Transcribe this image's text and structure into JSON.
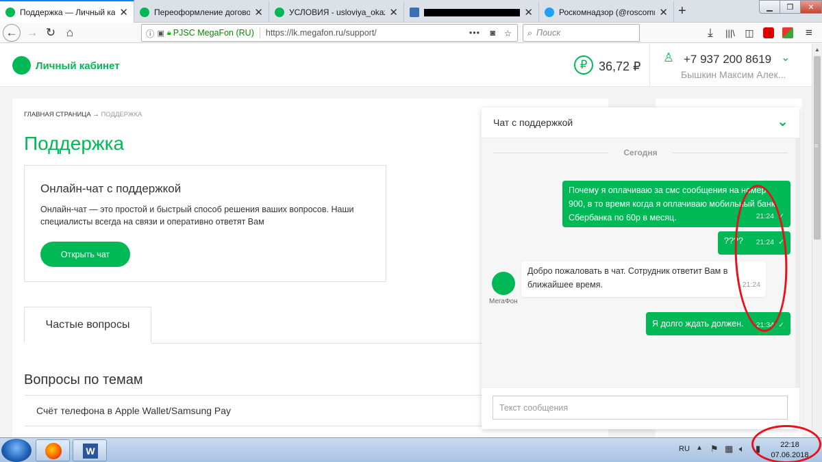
{
  "tabs": [
    {
      "label": "Поддержка — Личный кабинет",
      "icon": "megafon-logo-icon",
      "active": true
    },
    {
      "label": "Переоформление договора -",
      "icon": "megafon-logo-icon"
    },
    {
      "label": "УСЛОВИЯ - usloviya_okazaniya",
      "icon": "megafon-logo-icon"
    },
    {
      "label": "",
      "icon": "video-icon"
    },
    {
      "label": "Роскомнадзор (@roscomnadzor)",
      "icon": "twitter-icon"
    }
  ],
  "nav": {
    "identity": "PJSC MegaFon (RU)",
    "url": "https://lk.megafon.ru/support/",
    "search_placeholder": "Поиск"
  },
  "header": {
    "logo_text": "Личный кабинет",
    "balance": "36,72 ₽",
    "phone": "+7 937 200 8619",
    "user_name": "Бышкин Максим Алек..."
  },
  "breadcrumb": {
    "home": "ГЛАВНАЯ СТРАНИЦА",
    "arrow": "→",
    "current": "ПОДДЕРЖКА"
  },
  "page_title": "Поддержка",
  "online_chat": {
    "title": "Онлайн-чат с поддержкой",
    "description": "Онлайн-чат — это простой и быстрый способ решения ваших вопросов. Наши специалисты всегда на связи и оперативно ответят Вам",
    "button": "Открыть чат"
  },
  "faq_tab": "Частые вопросы",
  "topics": {
    "title": "Вопросы по темам",
    "items": [
      "Счёт телефона в Apple Wallet/Samsung Pay"
    ]
  },
  "chat": {
    "title": "Чат с поддержкой",
    "date_divider": "Сегодня",
    "messages": [
      {
        "from": "user",
        "text": "Почему я оплачиваю за смс сообщения на номер 900, в то время когда я оплачиваю мобильный банк Сбербанка по 60р в месяц.",
        "time": "21:24"
      },
      {
        "from": "user",
        "text": "????",
        "time": "21:24"
      },
      {
        "from": "support",
        "text": "Добро пожаловать в чат. Сотрудник ответит Вам в ближайшее время.",
        "time": "21:24"
      },
      {
        "from": "user",
        "text": "Я долго ждать должен.",
        "time": "21:34"
      }
    ],
    "support_label": "МегаФон",
    "input_placeholder": "Текст сообщения"
  },
  "taskbar": {
    "lang": "RU",
    "time": "22:18",
    "date": "07.06.2018"
  },
  "colors": {
    "brand": "#00b956",
    "annotation": "#e8101a"
  }
}
